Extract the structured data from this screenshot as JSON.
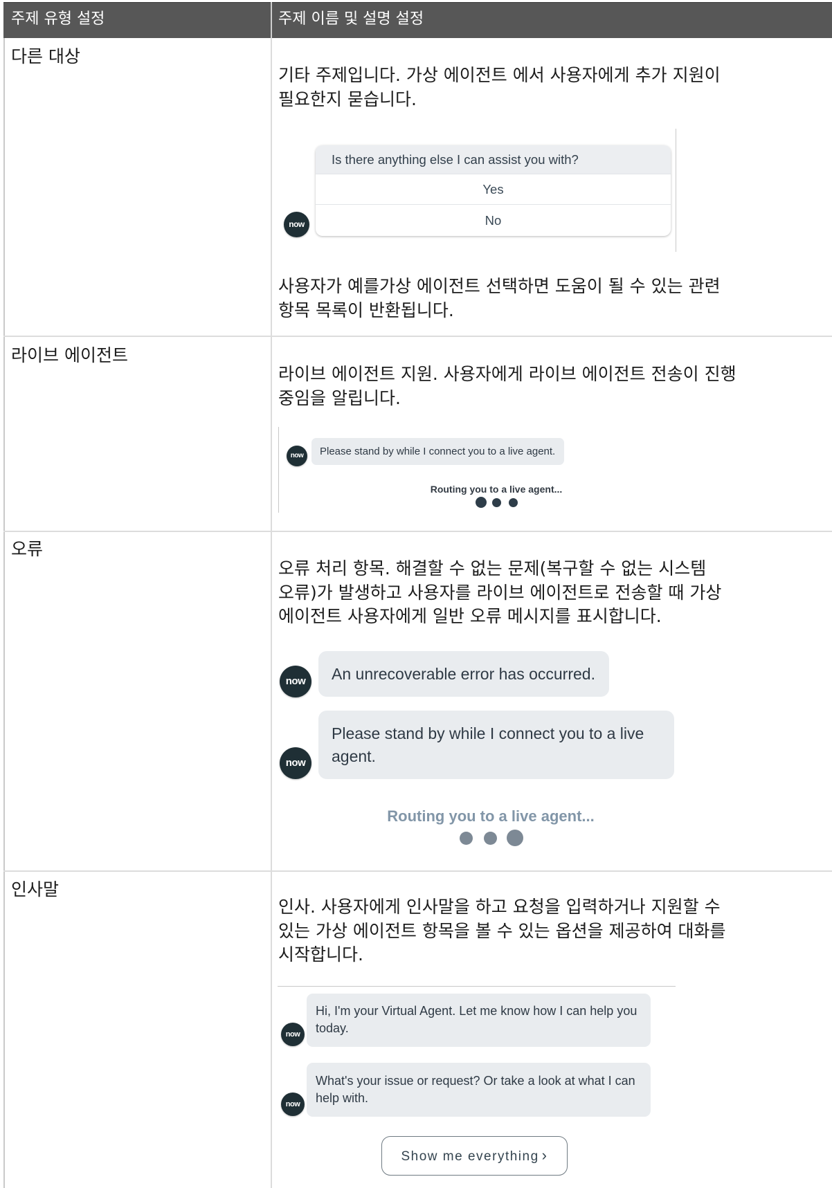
{
  "header": {
    "type_title": "주제 유형 설정",
    "name_title": "주제 이름 및 설명 설정"
  },
  "brand": {
    "logo_text": "now"
  },
  "theme": {
    "header_bg": "#575757",
    "grid_line": "#dcdcdc",
    "bubble_bg": "#e9ecef",
    "avatar_bg": "#1f2f35",
    "status_muted": "#8296a8"
  },
  "rows": [
    {
      "label": "다른 대상",
      "description_lines": [
        "기타 주제입니다. 가상 에이전트 에서 사용자에게 추가 지원이",
        "필요한지 묻습니다."
      ],
      "example": {
        "question": "Is there anything else I can assist you with?",
        "options": [
          "Yes",
          "No"
        ]
      },
      "note_lines": [
        "사용자가 예를가상 에이전트 선택하면 도움이 될 수 있는 관련",
        "항목 목록이 반환됩니다."
      ]
    },
    {
      "label": "라이브 에이전트",
      "description_lines": [
        "라이브 에이전트 지원. 사용자에게 라이브 에이전트 전송이 진행",
        "중임을 알립니다."
      ],
      "example": {
        "message": "Please stand by while I connect you to a live agent.",
        "status": "Routing you to a live agent..."
      }
    },
    {
      "label": "오류",
      "description_lines": [
        "오류 처리 항목. 해결할 수 없는 문제(복구할 수 없는 시스템",
        "오류)가 발생하고 사용자를 라이브 에이전트로 전송할 때 가상",
        "에이전트 사용자에게 일반 오류 메시지를 표시합니다."
      ],
      "example": {
        "messages": [
          "An unrecoverable error has occurred.",
          "Please stand by while I connect you to a live agent."
        ],
        "status": "Routing you to a live agent..."
      }
    },
    {
      "label": "인사말",
      "description_lines": [
        "인사. 사용자에게 인사말을 하고 요청을 입력하거나 지원할 수",
        "있는 가상 에이전트 항목을 볼 수 있는 옵션을 제공하여 대화를",
        "시작합니다."
      ],
      "example": {
        "messages": [
          "Hi, I'm your Virtual Agent. Let me know how I can help you today.",
          "What's your issue or request? Or take a look at what I can help with."
        ],
        "button_label": "Show me everything",
        "button_icon": "chevron-right",
        "button_icon_glyph": "›"
      }
    }
  ]
}
